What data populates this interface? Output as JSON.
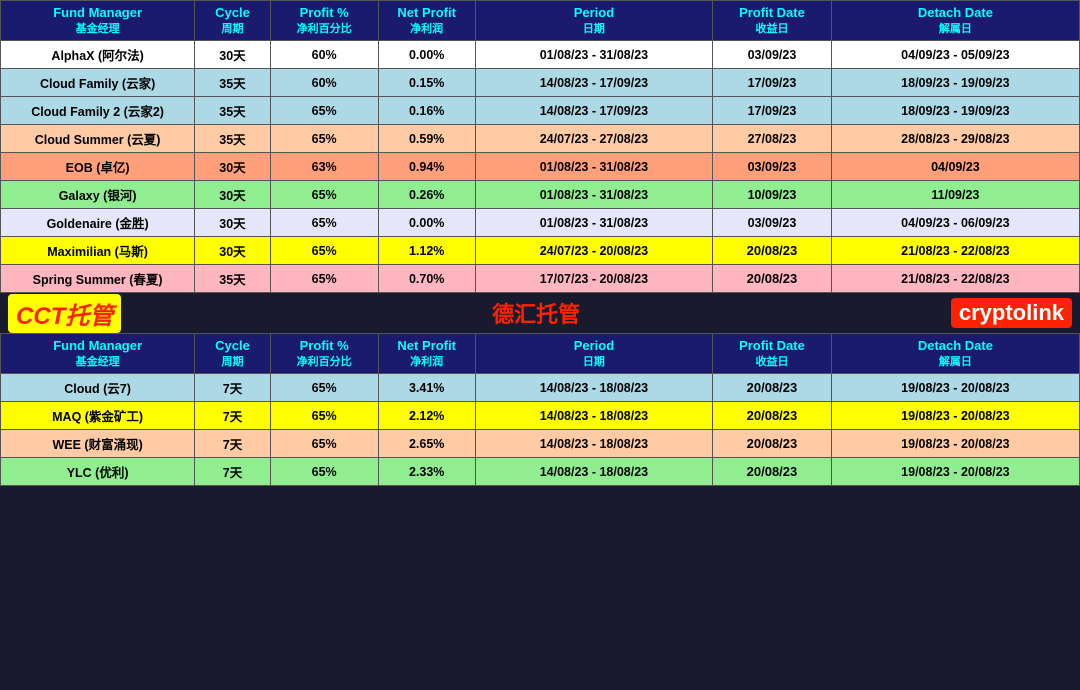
{
  "table1": {
    "headers": {
      "fund_manager": "Fund Manager",
      "fund_manager_zh": "基金经理",
      "cycle": "Cycle",
      "cycle_zh": "周期",
      "profit_pct": "Profit %",
      "profit_pct_zh": "净利百分比",
      "net_profit": "Net Profit",
      "net_profit_zh": "净利润",
      "period": "Period",
      "period_zh": "日期",
      "profit_date": "Profit Date",
      "profit_date_zh": "收益日",
      "detach_date": "Detach Date",
      "detach_date_zh": "解属日"
    },
    "rows": [
      {
        "fund": "AlphaX (阿尔法)",
        "cycle": "30天",
        "profit_pct": "60%",
        "net_profit": "0.00%",
        "period": "01/08/23 - 31/08/23",
        "profit_date": "03/09/23",
        "detach_date": "04/09/23 - 05/09/23",
        "row_class": "row-white",
        "profit_bold": false
      },
      {
        "fund": "Cloud Family (云家)",
        "cycle": "35天",
        "profit_pct": "60%",
        "net_profit": "0.15%",
        "period": "14/08/23 - 17/09/23",
        "profit_date": "17/09/23",
        "detach_date": "18/09/23 - 19/09/23",
        "row_class": "row-light-blue",
        "profit_bold": false
      },
      {
        "fund": "Cloud Family 2 (云家2)",
        "cycle": "35天",
        "profit_pct": "65%",
        "net_profit": "0.16%",
        "period": "14/08/23 - 17/09/23",
        "profit_date": "17/09/23",
        "detach_date": "18/09/23 - 19/09/23",
        "row_class": "row-light-blue",
        "profit_bold": false
      },
      {
        "fund": "Cloud Summer (云夏)",
        "cycle": "35天",
        "profit_pct": "65%",
        "net_profit": "0.59%",
        "period": "24/07/23 - 27/08/23",
        "profit_date": "27/08/23",
        "detach_date": "28/08/23 - 29/08/23",
        "row_class": "row-peach",
        "profit_bold": false
      },
      {
        "fund": "EOB (卓亿)",
        "cycle": "30天",
        "profit_pct": "63%",
        "net_profit": "0.94%",
        "period": "01/08/23 - 31/08/23",
        "profit_date": "03/09/23",
        "detach_date": "04/09/23",
        "row_class": "row-salmon",
        "profit_bold": false
      },
      {
        "fund": "Galaxy (银河)",
        "cycle": "30天",
        "profit_pct": "65%",
        "net_profit": "0.26%",
        "period": "01/08/23 - 31/08/23",
        "profit_date": "10/09/23",
        "detach_date": "11/09/23",
        "row_class": "row-light-green",
        "profit_bold": false
      },
      {
        "fund": "Goldenaire (金胜)",
        "cycle": "30天",
        "profit_pct": "65%",
        "net_profit": "0.00%",
        "period": "01/08/23 - 31/08/23",
        "profit_date": "03/09/23",
        "detach_date": "04/09/23 - 06/09/23",
        "row_class": "row-lavender",
        "profit_bold": false
      },
      {
        "fund": "Maximilian (马斯)",
        "cycle": "30天",
        "profit_pct": "65%",
        "net_profit": "1.12%",
        "period": "24/07/23 - 20/08/23",
        "profit_date": "20/08/23",
        "detach_date": "21/08/23 - 22/08/23",
        "row_class": "row-yellow",
        "profit_bold": true
      },
      {
        "fund": "Spring Summer (春夏)",
        "cycle": "35天",
        "profit_pct": "65%",
        "net_profit": "0.70%",
        "period": "17/07/23 - 20/08/23",
        "profit_date": "20/08/23",
        "detach_date": "21/08/23 - 22/08/23",
        "row_class": "row-pink",
        "profit_bold": true
      }
    ]
  },
  "divider": {
    "cct": "CCT托管",
    "dehui": "德汇托管",
    "crypto": "cryptolink"
  },
  "table2": {
    "rows": [
      {
        "fund": "Cloud (云7)",
        "cycle": "7天",
        "profit_pct": "65%",
        "net_profit": "3.41%",
        "period": "14/08/23 - 18/08/23",
        "profit_date": "20/08/23",
        "detach_date": "19/08/23 - 20/08/23",
        "row_class": "row-light-blue",
        "profit_bold": true
      },
      {
        "fund": "MAQ (紫金矿工)",
        "cycle": "7天",
        "profit_pct": "65%",
        "net_profit": "2.12%",
        "period": "14/08/23 - 18/08/23",
        "profit_date": "20/08/23",
        "detach_date": "19/08/23 - 20/08/23",
        "row_class": "row-yellow",
        "profit_bold": true
      },
      {
        "fund": "WEE (财富涌现)",
        "cycle": "7天",
        "profit_pct": "65%",
        "net_profit": "2.65%",
        "period": "14/08/23 - 18/08/23",
        "profit_date": "20/08/23",
        "detach_date": "19/08/23 - 20/08/23",
        "row_class": "row-peach",
        "profit_bold": true
      },
      {
        "fund": "YLC (优利)",
        "cycle": "7天",
        "profit_pct": "65%",
        "net_profit": "2.33%",
        "period": "14/08/23 - 18/08/23",
        "profit_date": "20/08/23",
        "detach_date": "19/08/23 - 20/08/23",
        "row_class": "row-light-green",
        "profit_bold": true
      }
    ]
  }
}
